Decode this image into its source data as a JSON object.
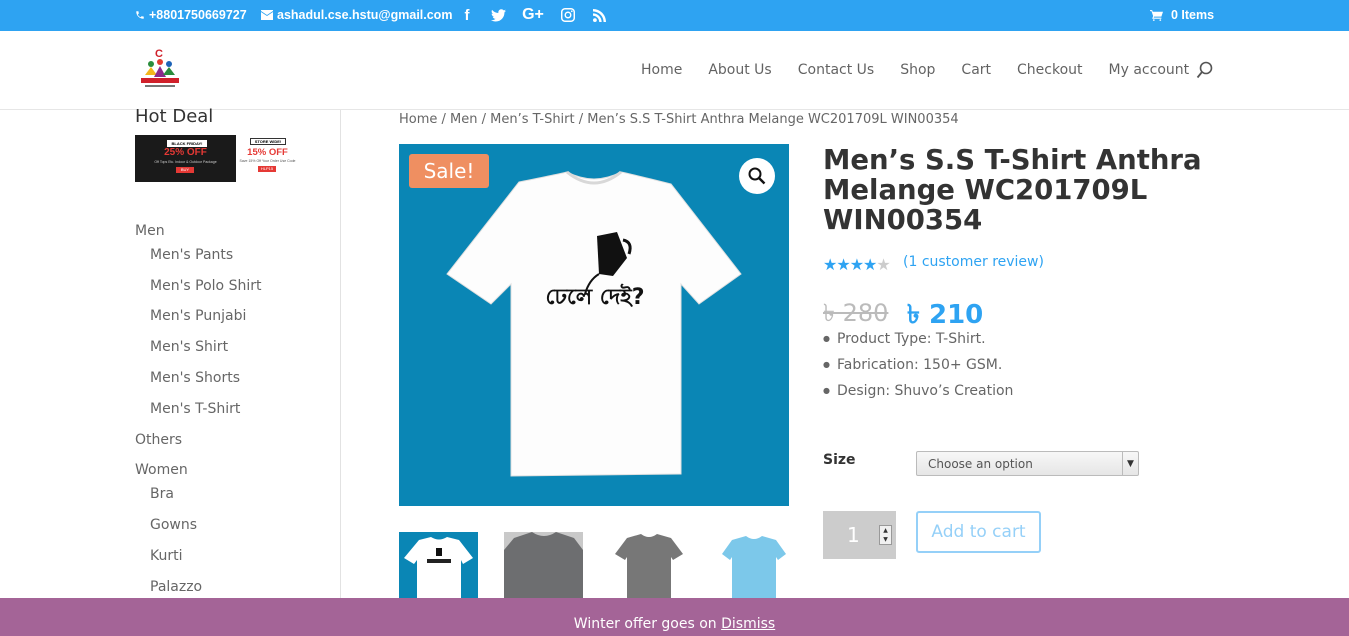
{
  "topbar": {
    "phone": "+8801750669727",
    "email": "ashadul.cse.hstu@gmail.com",
    "cart": "0 Items",
    "social_icons": [
      "facebook-icon",
      "twitter-icon",
      "google-plus-icon",
      "instagram-icon",
      "rss-icon"
    ]
  },
  "nav": {
    "items": [
      "Home",
      "About Us",
      "Contact Us",
      "Shop",
      "Cart",
      "Checkout",
      "My account"
    ]
  },
  "sidebar": {
    "hot_deal_title": "Hot Deal",
    "banner1": {
      "top": "BLACK FRIDAY!",
      "big": "25% OFF",
      "small": "Off Tops Etc. Indoor & Outdoor Package",
      "btn": "BUY"
    },
    "banner2": {
      "top": "STORE WIDE!",
      "big": "15% OFF",
      "small": "Save 15% Off Your Order Use Code",
      "btn": "HLP15"
    },
    "categories": [
      {
        "label": "Men",
        "level": 0
      },
      {
        "label": "Men's Pants",
        "level": 1
      },
      {
        "label": "Men's Polo Shirt",
        "level": 1
      },
      {
        "label": "Men's Punjabi",
        "level": 1
      },
      {
        "label": "Men's Shirt",
        "level": 1
      },
      {
        "label": "Men's Shorts",
        "level": 1
      },
      {
        "label": "Men's T-Shirt",
        "level": 1
      },
      {
        "label": "Others",
        "level": 0
      },
      {
        "label": "Women",
        "level": 0
      },
      {
        "label": "Bra",
        "level": 1
      },
      {
        "label": "Gowns",
        "level": 1
      },
      {
        "label": "Kurti",
        "level": 1
      },
      {
        "label": "Palazzo",
        "level": 1
      }
    ]
  },
  "breadcrumb": "Home / Men / Men’s T-Shirt / Men’s S.S T-Shirt Anthra Melange WC201709L WIN00354",
  "product": {
    "sale_badge": "Sale!",
    "shirt_text": "ঢেলে দেই?",
    "title": "Men’s S.S T-Shirt Anthra Melange WC201709L WIN00354",
    "rating": 4,
    "rating_max": 5,
    "review_link": "(1 customer review)",
    "old_price": "৳ 280",
    "new_price": "৳ 210",
    "bullets": [
      "Product Type: T-Shirt.",
      "Fabrication: 150+ GSM.",
      "Design: Shuvo’s Creation"
    ],
    "size_label": "Size",
    "size_select": "Choose an option",
    "quantity": "1",
    "add_to_cart": "Add to cart",
    "thumb_colors": [
      "#0a86b5",
      "#6d6e70",
      "#ffffff",
      "#ffffff"
    ]
  },
  "notice": {
    "text": "Winter offer goes on ",
    "dismiss": "Dismiss"
  },
  "colors": {
    "accent": "#2ea3f2",
    "notice_bg": "#a46497",
    "sale_badge": "#ef8f61",
    "product_bg": "#0a86b5"
  }
}
